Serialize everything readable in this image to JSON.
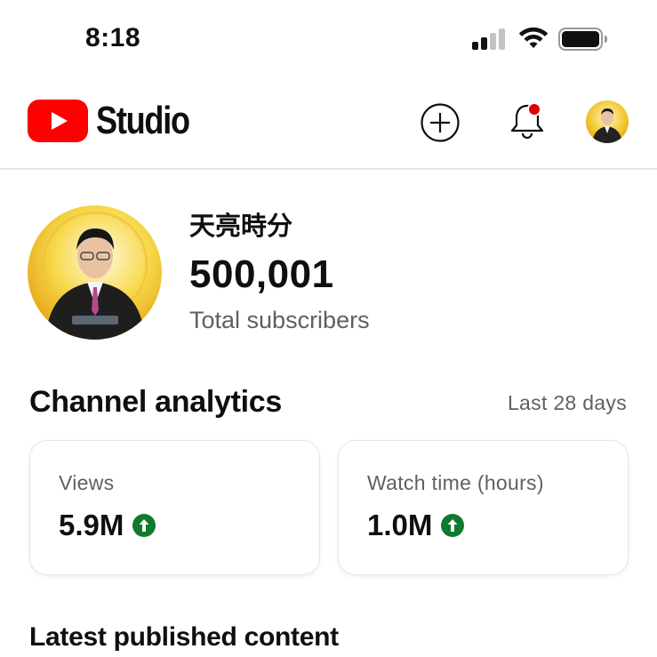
{
  "status_bar": {
    "time": "8:18",
    "icons": [
      "signal-icon",
      "wifi-icon",
      "battery-icon"
    ]
  },
  "header": {
    "logo_icon": "youtube-play-icon",
    "title": "Studio",
    "actions": [
      "create-icon",
      "notifications-bell-icon",
      "account-avatar"
    ],
    "notification_dot_color": "#e00000",
    "brand_color": "#ff0000"
  },
  "channel": {
    "name": "天亮時分",
    "subscriber_count": "500,001",
    "subscriber_label": "Total subscribers"
  },
  "analytics": {
    "title": "Channel analytics",
    "period": "Last 28 days",
    "metrics": [
      {
        "label": "Views",
        "value": "5.9M",
        "trend": "up",
        "trend_icon": "arrow-up-circle-icon"
      },
      {
        "label": "Watch time (hours)",
        "value": "1.0M",
        "trend": "up",
        "trend_icon": "arrow-up-circle-icon"
      }
    ],
    "trend_up_color": "#0f7a2e"
  },
  "latest": {
    "title": "Latest published content"
  }
}
